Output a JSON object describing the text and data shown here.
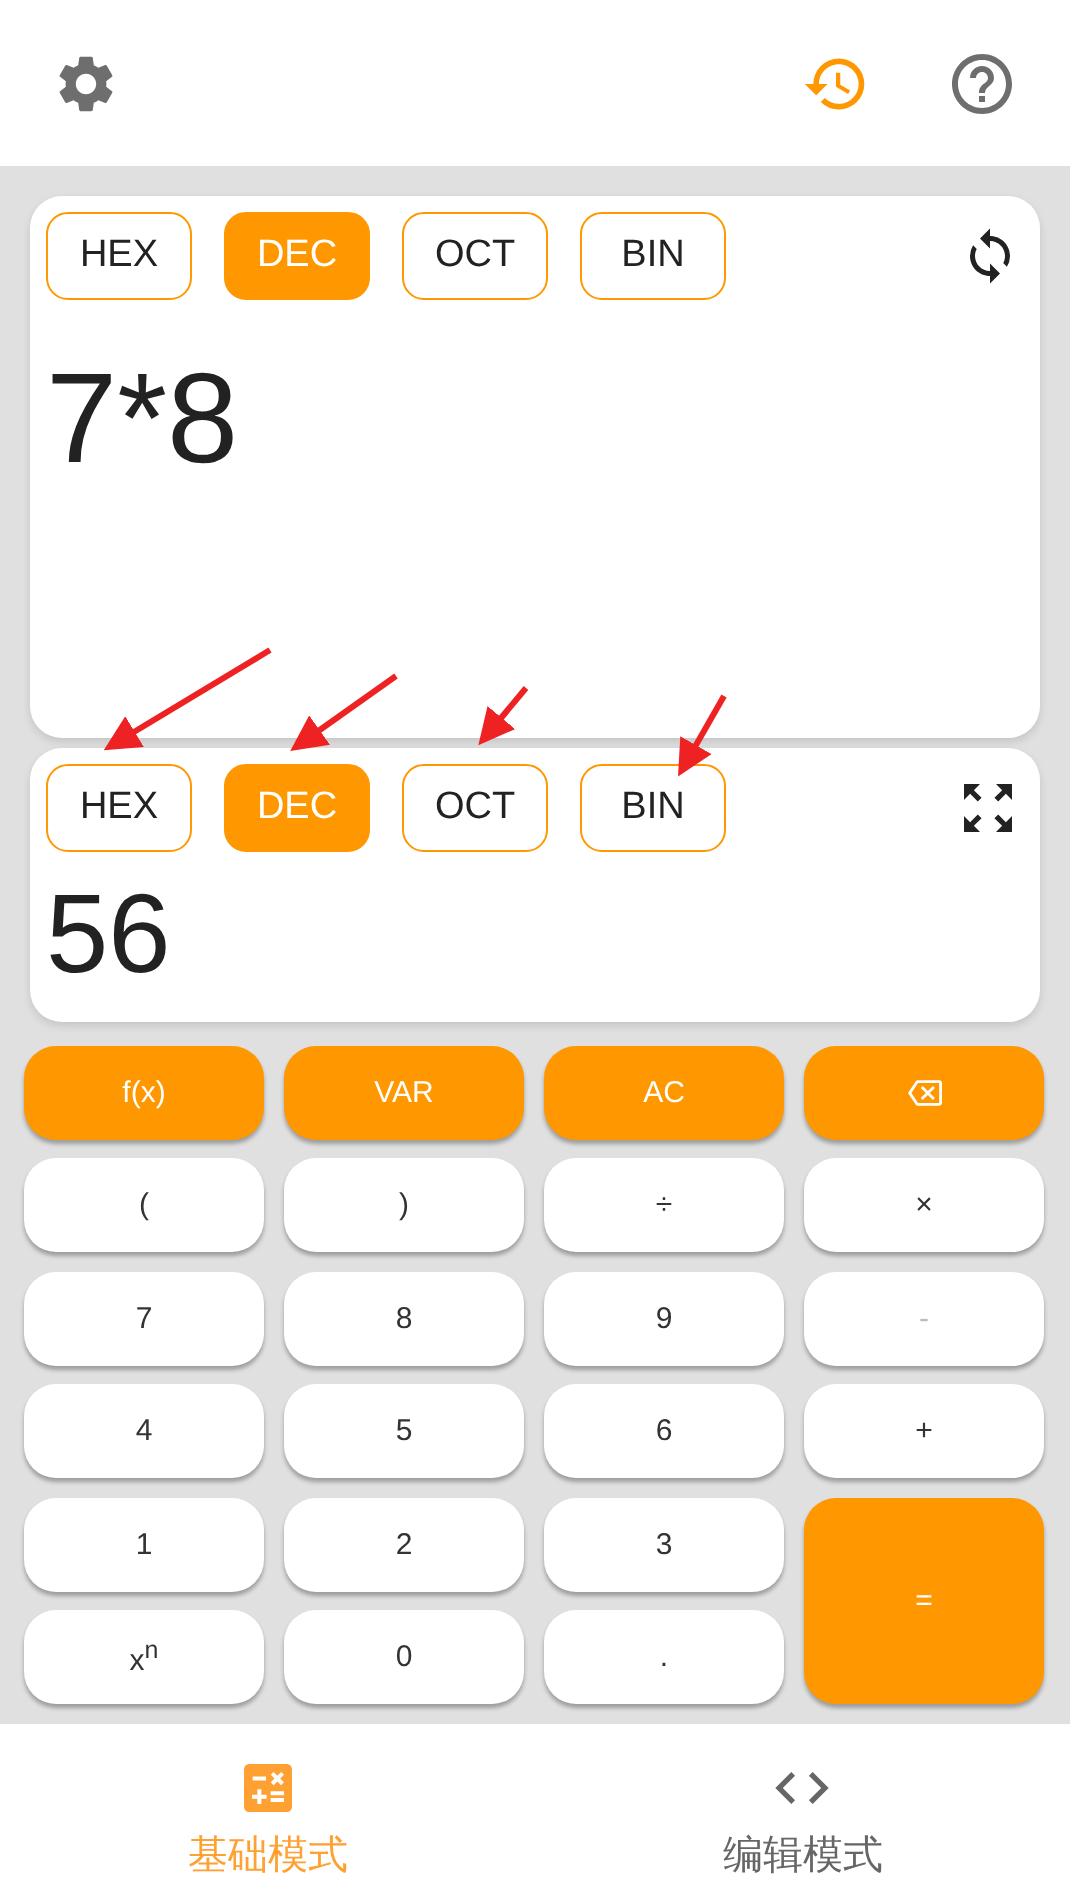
{
  "input_panel": {
    "bases": [
      {
        "label": "HEX",
        "selected": false
      },
      {
        "label": "DEC",
        "selected": true
      },
      {
        "label": "OCT",
        "selected": false
      },
      {
        "label": "BIN",
        "selected": false
      }
    ],
    "expression": "7*8"
  },
  "output_panel": {
    "bases": [
      {
        "label": "HEX",
        "selected": false
      },
      {
        "label": "DEC",
        "selected": true
      },
      {
        "label": "OCT",
        "selected": false
      },
      {
        "label": "BIN",
        "selected": false
      }
    ],
    "result": "56"
  },
  "keypad": [
    {
      "label": "f(x)",
      "kind": "accent",
      "disabled": false
    },
    {
      "label": "VAR",
      "kind": "accent",
      "disabled": false
    },
    {
      "label": "AC",
      "kind": "accent",
      "disabled": false
    },
    {
      "kind": "backspace",
      "disabled": false
    },
    {
      "label": "(",
      "kind": "plain",
      "disabled": false
    },
    {
      "label": ")",
      "kind": "plain",
      "disabled": false
    },
    {
      "label": "÷",
      "kind": "plain",
      "disabled": false
    },
    {
      "label": "×",
      "kind": "plain",
      "disabled": false
    },
    {
      "label": "7",
      "kind": "plain",
      "disabled": false
    },
    {
      "label": "8",
      "kind": "plain",
      "disabled": false
    },
    {
      "label": "9",
      "kind": "plain",
      "disabled": false
    },
    {
      "label": "-",
      "kind": "plain",
      "disabled": true
    },
    {
      "label": "4",
      "kind": "plain",
      "disabled": false
    },
    {
      "label": "5",
      "kind": "plain",
      "disabled": false
    },
    {
      "label": "6",
      "kind": "plain",
      "disabled": false
    },
    {
      "label": "+",
      "kind": "plain",
      "disabled": false
    },
    {
      "label": "1",
      "kind": "plain",
      "disabled": false
    },
    {
      "label": "2",
      "kind": "plain",
      "disabled": false
    },
    {
      "label": "3",
      "kind": "plain",
      "disabled": false
    },
    {
      "label": "=",
      "kind": "equals",
      "disabled": false
    },
    {
      "label": "x$^{n}$",
      "kind": "plain",
      "disabled": false
    },
    {
      "label": "0",
      "kind": "plain",
      "disabled": false
    },
    {
      "label": ".",
      "kind": "plain",
      "disabled": false
    }
  ],
  "bottom_nav": [
    {
      "label": "基础模式",
      "selected": true
    },
    {
      "label": "编辑模式",
      "selected": false
    }
  ]
}
